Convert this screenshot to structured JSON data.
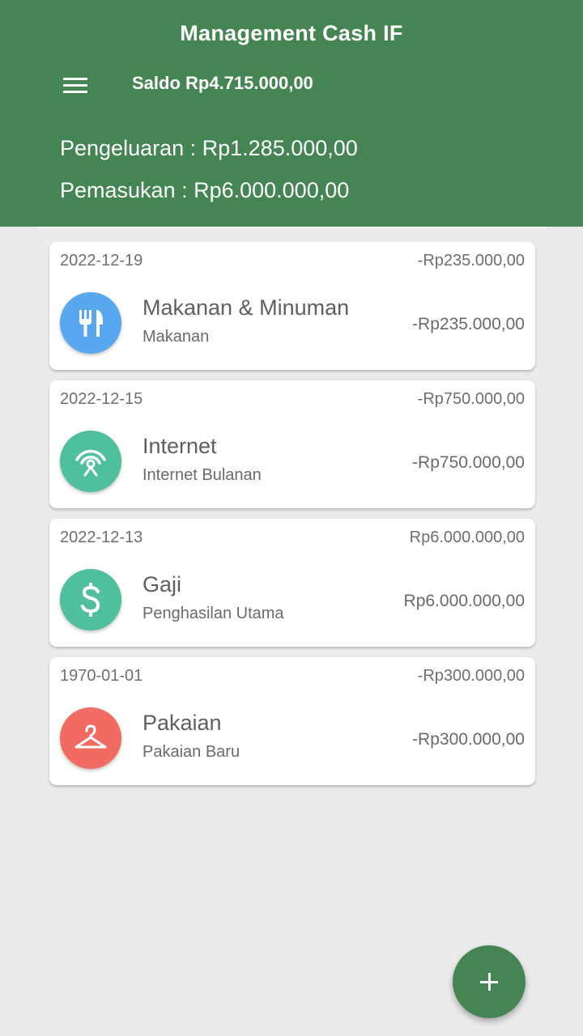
{
  "app": {
    "title": "Management Cash IF",
    "menu_icon": "menu-icon"
  },
  "summary": {
    "saldo": "Saldo Rp4.715.000,00",
    "pengeluaran": "Pengeluaran : Rp1.285.000,00",
    "pemasukan": "Pemasukan : Rp6.000.000,00"
  },
  "colors": {
    "primary": "#458553",
    "food": "#58a8f0",
    "internet": "#4fbfa0",
    "salary": "#4fbfa0",
    "clothes": "#f26b62"
  },
  "transactions": [
    {
      "date": "2022-12-19",
      "amount_top": "-Rp235.000,00",
      "category": "Makanan & Minuman",
      "note": "Makanan",
      "amount": "-Rp235.000,00",
      "icon": "restaurant-icon",
      "color": "#58a8f0"
    },
    {
      "date": "2022-12-15",
      "amount_top": "-Rp750.000,00",
      "category": "Internet",
      "note": "Internet Bulanan",
      "amount": "-Rp750.000,00",
      "icon": "wifi-antenna-icon",
      "color": "#4fbfa0"
    },
    {
      "date": "2022-12-13",
      "amount_top": "Rp6.000.000,00",
      "category": "Gaji",
      "note": "Penghasilan Utama",
      "amount": "Rp6.000.000,00",
      "icon": "dollar-icon",
      "color": "#4fbfa0"
    },
    {
      "date": "1970-01-01",
      "amount_top": "-Rp300.000,00",
      "category": "Pakaian",
      "note": "Pakaian Baru",
      "amount": "-Rp300.000,00",
      "icon": "hanger-icon",
      "color": "#f26b62"
    }
  ],
  "fab": {
    "icon": "plus-icon"
  }
}
